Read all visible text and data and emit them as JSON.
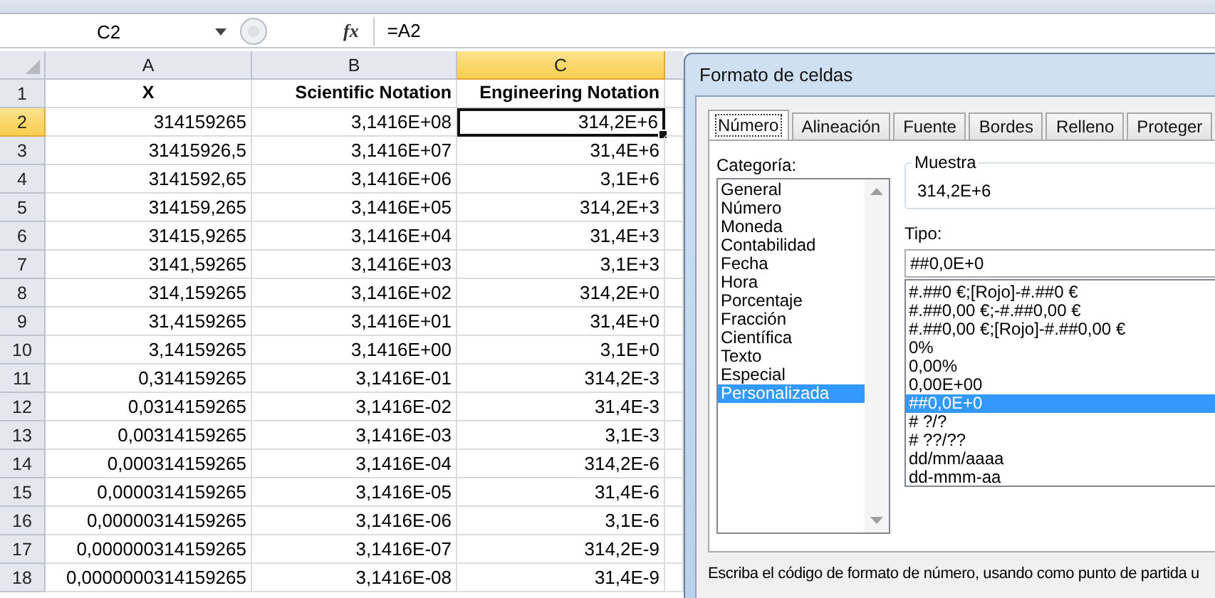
{
  "formula_bar": {
    "name_box": "C2",
    "fx": "fx",
    "formula": "=A2"
  },
  "sheet": {
    "columns": [
      {
        "label": "A",
        "selected": false
      },
      {
        "label": "B",
        "selected": false
      },
      {
        "label": "C",
        "selected": true
      }
    ],
    "rows": [
      {
        "label": "1",
        "selected": false,
        "header": true,
        "cells": [
          "X",
          "Scientific Notation",
          "Engineering Notation"
        ]
      },
      {
        "label": "2",
        "selected": true,
        "cells": [
          "314159265",
          "3,1416E+08",
          "314,2E+6"
        ]
      },
      {
        "label": "3",
        "selected": false,
        "cells": [
          "31415926,5",
          "3,1416E+07",
          "31,4E+6"
        ]
      },
      {
        "label": "4",
        "selected": false,
        "cells": [
          "3141592,65",
          "3,1416E+06",
          "3,1E+6"
        ]
      },
      {
        "label": "5",
        "selected": false,
        "cells": [
          "314159,265",
          "3,1416E+05",
          "314,2E+3"
        ]
      },
      {
        "label": "6",
        "selected": false,
        "cells": [
          "31415,9265",
          "3,1416E+04",
          "31,4E+3"
        ]
      },
      {
        "label": "7",
        "selected": false,
        "cells": [
          "3141,59265",
          "3,1416E+03",
          "3,1E+3"
        ]
      },
      {
        "label": "8",
        "selected": false,
        "cells": [
          "314,159265",
          "3,1416E+02",
          "314,2E+0"
        ]
      },
      {
        "label": "9",
        "selected": false,
        "cells": [
          "31,4159265",
          "3,1416E+01",
          "31,4E+0"
        ]
      },
      {
        "label": "10",
        "selected": false,
        "cells": [
          "3,14159265",
          "3,1416E+00",
          "3,1E+0"
        ]
      },
      {
        "label": "11",
        "selected": false,
        "cells": [
          "0,314159265",
          "3,1416E-01",
          "314,2E-3"
        ]
      },
      {
        "label": "12",
        "selected": false,
        "cells": [
          "0,0314159265",
          "3,1416E-02",
          "31,4E-3"
        ]
      },
      {
        "label": "13",
        "selected": false,
        "cells": [
          "0,00314159265",
          "3,1416E-03",
          "3,1E-3"
        ]
      },
      {
        "label": "14",
        "selected": false,
        "cells": [
          "0,000314159265",
          "3,1416E-04",
          "314,2E-6"
        ]
      },
      {
        "label": "15",
        "selected": false,
        "cells": [
          "0,0000314159265",
          "3,1416E-05",
          "31,4E-6"
        ]
      },
      {
        "label": "16",
        "selected": false,
        "cells": [
          "0,00000314159265",
          "3,1416E-06",
          "3,1E-6"
        ]
      },
      {
        "label": "17",
        "selected": false,
        "cells": [
          "0,000000314159265",
          "3,1416E-07",
          "314,2E-9"
        ]
      },
      {
        "label": "18",
        "selected": false,
        "cells": [
          "0,0000000314159265",
          "3,1416E-08",
          "31,4E-9"
        ]
      }
    ]
  },
  "dialog": {
    "title": "Formato de celdas",
    "tabs": [
      {
        "label": "Número",
        "selected": true
      },
      {
        "label": "Alineación",
        "selected": false
      },
      {
        "label": "Fuente",
        "selected": false
      },
      {
        "label": "Bordes",
        "selected": false
      },
      {
        "label": "Relleno",
        "selected": false
      },
      {
        "label": "Proteger",
        "selected": false
      }
    ],
    "category_label": "Categoría:",
    "categories": [
      {
        "label": "General",
        "selected": false
      },
      {
        "label": "Número",
        "selected": false
      },
      {
        "label": "Moneda",
        "selected": false
      },
      {
        "label": "Contabilidad",
        "selected": false
      },
      {
        "label": "Fecha",
        "selected": false
      },
      {
        "label": "Hora",
        "selected": false
      },
      {
        "label": "Porcentaje",
        "selected": false
      },
      {
        "label": "Fracción",
        "selected": false
      },
      {
        "label": "Científica",
        "selected": false
      },
      {
        "label": "Texto",
        "selected": false
      },
      {
        "label": "Especial",
        "selected": false
      },
      {
        "label": "Personalizada",
        "selected": true
      }
    ],
    "sample_label": "Muestra",
    "sample": "314,2E+6",
    "type_label": "Tipo:",
    "type_value": "##0,0E+0",
    "types": [
      {
        "label": "#.##0 €;[Rojo]-#.##0 €",
        "selected": false
      },
      {
        "label": "#.##0,00 €;-#.##0,00 €",
        "selected": false
      },
      {
        "label": "#.##0,00 €;[Rojo]-#.##0,00 €",
        "selected": false
      },
      {
        "label": "0%",
        "selected": false
      },
      {
        "label": "0,00%",
        "selected": false
      },
      {
        "label": "0,00E+00",
        "selected": false
      },
      {
        "label": "##0,0E+0",
        "selected": true
      },
      {
        "label": "# ?/?",
        "selected": false
      },
      {
        "label": "# ??/??",
        "selected": false
      },
      {
        "label": "dd/mm/aaaa",
        "selected": false
      },
      {
        "label": "dd-mmm-aa",
        "selected": false
      }
    ],
    "description": "Escriba el código de formato de número, usando como punto de partida u"
  }
}
